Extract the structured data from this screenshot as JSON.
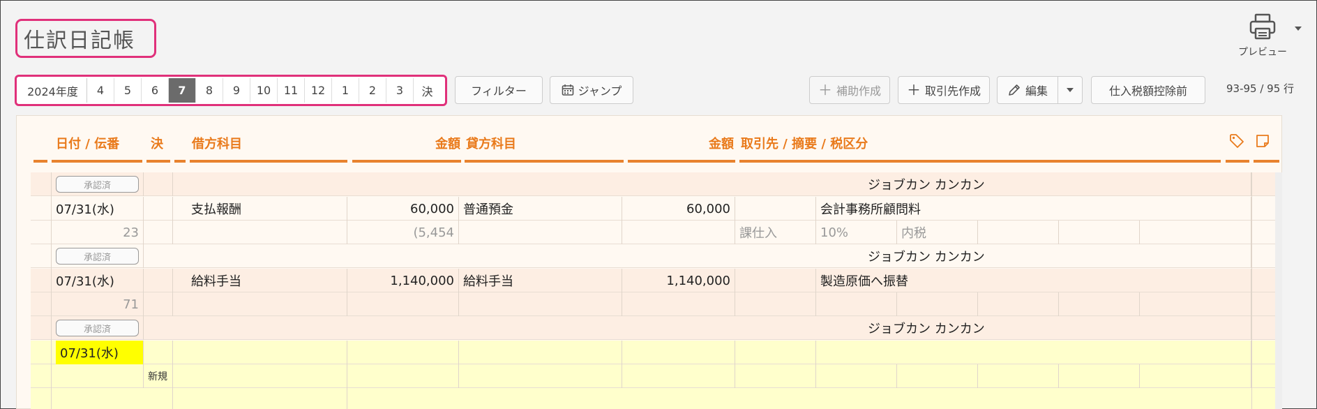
{
  "page": {
    "title": "仕訳日記帳"
  },
  "preview": {
    "label": "プレビュー",
    "icon": "printer-icon"
  },
  "months": {
    "fiscal_year": "2024年度",
    "items": [
      "4",
      "5",
      "6",
      "7",
      "8",
      "9",
      "10",
      "11",
      "12",
      "1",
      "2",
      "3",
      "決"
    ],
    "active": "7"
  },
  "toolbar": {
    "filter_label": "フィルター",
    "jump_label": "ジャンプ",
    "aux_create_label": "補助作成",
    "partner_create_label": "取引先作成",
    "edit_label": "編集",
    "tax_label": "仕入税額控除前",
    "row_count": "93-95 / 95 行"
  },
  "columns": {
    "date": "日付 / 伝番",
    "settle": "決",
    "debit_account": "借方科目",
    "debit_amount": "金額",
    "credit_account": "貸方科目",
    "credit_amount": "金額",
    "partner": "取引先 / 摘要 / 税区分"
  },
  "entries": [
    {
      "status": "承認済",
      "user": "ジョブカン カンカン"
    },
    {
      "date": "07/31(水)",
      "number": "23",
      "debit_account": "支払報酬",
      "debit_amount": "60,000",
      "debit_tax": "(5,454",
      "credit_account": "普通預金",
      "credit_amount": "60,000",
      "description": "会計事務所顧問料",
      "tax_category": "課仕入",
      "tax_rate": "10%",
      "tax_type": "内税",
      "status": "承認済",
      "user": "ジョブカン カンカン"
    },
    {
      "date": "07/31(水)",
      "number": "71",
      "debit_account": "給料手当",
      "debit_amount": "1,140,000",
      "credit_account": "給料手当",
      "credit_amount": "1,140,000",
      "description": "製造原価へ振替",
      "status": "承認済",
      "user": "ジョブカン カンカン"
    },
    {
      "date": "07/31(水)",
      "new_label": "新規"
    }
  ],
  "colors": {
    "accent": "#e97a1b",
    "highlight": "#e0307a",
    "new_row": "#ffffcc",
    "active_month": "#6b6b6b"
  }
}
